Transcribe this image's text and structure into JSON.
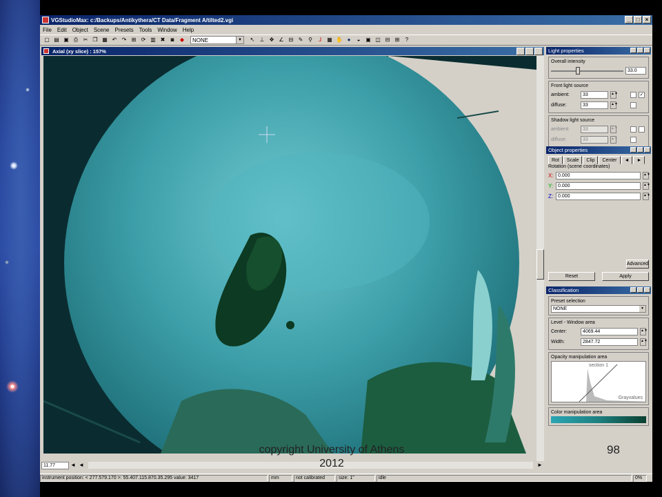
{
  "app": {
    "title": "VGStudioMax: c:/Backups/Antikythera/CT Data/Fragment A/tilted2.vgi",
    "menus": [
      "File",
      "Edit",
      "Object",
      "Scene",
      "Presets",
      "Tools",
      "Window",
      "Help"
    ],
    "toolbar_select": "NONE"
  },
  "viewer": {
    "title": "Axial (xy slice) : 157%",
    "zoom": "11.77"
  },
  "light": {
    "title": "Light properties",
    "overall_label": "Overall intensity",
    "overall_value": "33.0",
    "front_label": "Front light source",
    "ambient_label": "ambient:",
    "ambient": "33",
    "diffuse_label": "diffuse:",
    "diffuse": "33",
    "shadow_label": "Shadow light source",
    "s_ambient": "33",
    "s_diffuse": "33",
    "check": "✓"
  },
  "object": {
    "title": "Object properties",
    "tabs": [
      "Rot",
      "Scale",
      "Clip",
      "Center"
    ],
    "rotation_label": "Rotation (scene coordinates)",
    "x_label": "X:",
    "x": "0.000",
    "y_label": "Y:",
    "y": "0.000",
    "z_label": "Z:",
    "z": "0.000",
    "advanced": "Advanced",
    "reset": "Reset",
    "apply": "Apply"
  },
  "classification": {
    "title": "Classification",
    "preset_label": "Preset selection",
    "preset": "NONE",
    "level_label": "Level - Window area",
    "center_label": "Center:",
    "center": "4069.44",
    "width_label": "Width:",
    "width": "2847.72",
    "opacity_label": "Opacity manipulation area",
    "section": "section 1",
    "grayvalues": "Grayvalues",
    "color_label": "Color manipulation area"
  },
  "status": {
    "position": "instrument position: < 277.579.170 >: 55.407.115.870.35.295  value: 3417",
    "unit": "mm",
    "calib": "not calibrated",
    "size": "size: 1\"",
    "state": "idle",
    "pct": "0%"
  },
  "slide": {
    "copyright": "copyright University of Athens 2012",
    "page": "98"
  },
  "colors": {
    "titlebar": "#0a246a",
    "slice_cyan": "#2a8a92"
  }
}
